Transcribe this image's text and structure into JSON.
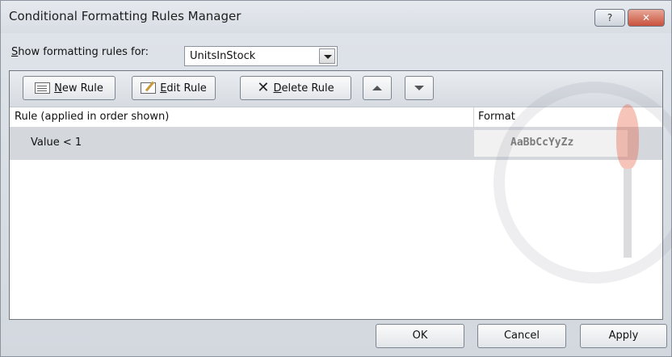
{
  "window": {
    "title": "Conditional Formatting Rules Manager",
    "help_label": "?",
    "close_label": "✕"
  },
  "scope": {
    "label_first": "S",
    "label_rest": "how formatting rules for:",
    "selected": "UnitsInStock"
  },
  "toolbar": {
    "new_rule": {
      "mnemonic": "N",
      "rest": "ew Rule"
    },
    "edit_rule": {
      "mnemonic": "E",
      "rest": "dit Rule"
    },
    "delete_rule": {
      "mnemonic": "D",
      "rest": "elete Rule"
    }
  },
  "table": {
    "columns": [
      "Rule (applied in order shown)",
      "Format"
    ],
    "rows": [
      {
        "rule": "Value < 1",
        "preview": "AaBbCcYyZz"
      }
    ]
  },
  "footer": {
    "ok": "OK",
    "cancel": "Cancel",
    "apply": "Apply"
  }
}
